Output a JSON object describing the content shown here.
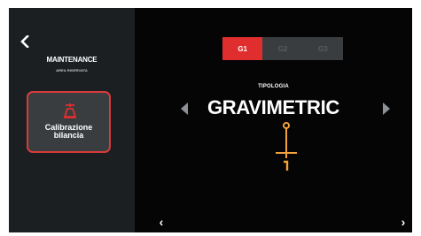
{
  "sidebar": {
    "back_icon": "chevron-left-icon",
    "title": "MAINTENANCE",
    "subtitle": "AREA RISERVATA",
    "card": {
      "icon": "scale-icon",
      "label_line1": "Calibrazione",
      "label_line2": "bilancia",
      "accent": "#d83b3b"
    }
  },
  "main": {
    "tabs": [
      {
        "label": "G1",
        "active": true
      },
      {
        "label": "G2",
        "active": false
      },
      {
        "label": "G3",
        "active": false
      }
    ],
    "tipologia_label": "TIPOLOGIA",
    "type_value": "GRAVIMETRIC",
    "prev_icon": "chevron-left-icon",
    "next_icon": "chevron-right-icon",
    "footer_prev": "‹",
    "footer_next": "›"
  },
  "colors": {
    "accent_red": "#e02e2e",
    "accent_orange": "#f3a13a",
    "background": "#050505",
    "sidebar": "#1c1f22"
  }
}
